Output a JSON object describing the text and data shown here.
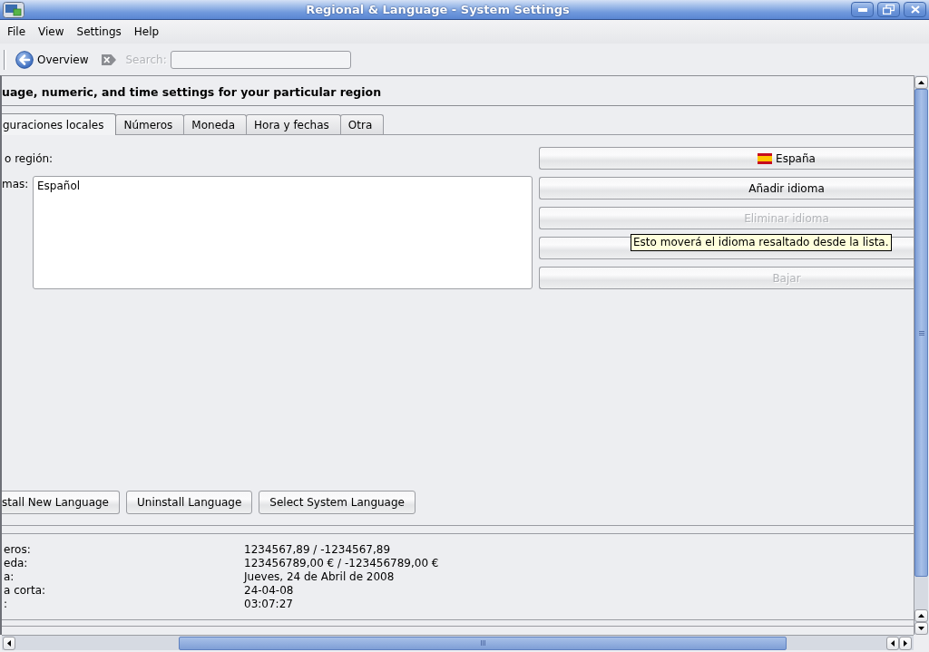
{
  "window": {
    "title": "Regional & Language - System Settings"
  },
  "menu_bar": [
    {
      "label": "File"
    },
    {
      "label": "View"
    },
    {
      "label": "Settings"
    },
    {
      "label": "Help"
    }
  ],
  "toolbar": {
    "overview_button": "Overview",
    "search": {
      "label": "Search:",
      "disabled": true
    }
  },
  "module": {
    "header": "uage, numeric, and time settings for your particular region",
    "tabs": [
      {
        "label": "guraciones locales",
        "selected": true
      },
      {
        "label": "Números",
        "selected": false
      },
      {
        "label": "Moneda",
        "selected": false
      },
      {
        "label": "Hora y fechas",
        "selected": false
      },
      {
        "label": "Otra",
        "selected": false
      }
    ],
    "country": {
      "label": "o región:",
      "value": "España"
    },
    "languages": {
      "label": "mas:",
      "items": [
        {
          "label": "Español",
          "selected": false
        }
      ]
    },
    "language_buttons": [
      {
        "label": "Añadir idioma",
        "disabled": false
      },
      {
        "label": "Eliminar idioma",
        "disabled": true
      },
      {
        "tooltip": "Esto moverá el idioma resaltado desde la lista."
      },
      {
        "label": "Bajar",
        "disabled": true
      }
    ],
    "install_buttons": [
      {
        "label": "stall New Language"
      },
      {
        "label": "Uninstall Language"
      },
      {
        "label": "Select System Language"
      }
    ],
    "examples": [
      {
        "label": "eros:",
        "value": "1234567,89 / -1234567,89"
      },
      {
        "label": "eda:",
        "value": "123456789,00 € / -123456789,00 €"
      },
      {
        "label": "a:",
        "value": "Jueves, 24 de Abril de 2008"
      },
      {
        "label": "a corta:",
        "value": "24-04-08"
      },
      {
        "label": ":",
        "value": "03:07:27"
      }
    ]
  }
}
